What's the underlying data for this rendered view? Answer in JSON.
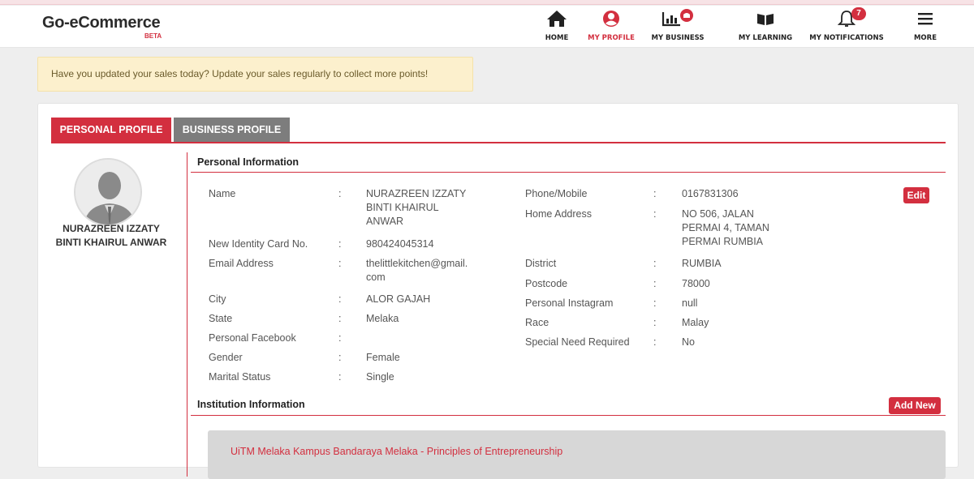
{
  "brand": {
    "name": "Go-eCommerce",
    "tag": "BETA"
  },
  "nav": [
    {
      "label": "HOME",
      "icon": "home-icon",
      "active": false,
      "badge": ""
    },
    {
      "label": "MY PROFILE",
      "icon": "user-icon",
      "active": true,
      "badge": ""
    },
    {
      "label": "MY BUSINESS",
      "icon": "bar-chart-icon",
      "active": false,
      "badge": ""
    },
    {
      "label": "MY LEARNING",
      "icon": "book-icon",
      "active": false,
      "badge": ""
    },
    {
      "label": "MY NOTIFICATIONS",
      "icon": "bell-icon",
      "active": false,
      "badge": "7"
    },
    {
      "label": "MORE",
      "icon": "menu-icon",
      "active": false,
      "badge": ""
    }
  ],
  "alert": {
    "text": "Have you updated your sales today? Update your sales regularly to collect more points!"
  },
  "tabs": {
    "personal": "PERSONAL PROFILE",
    "business": "BUSINESS PROFILE"
  },
  "profile": {
    "name_line1": "NURAZREEN IZZATY",
    "name_line2": "BINTI KHAIRUL ANWAR"
  },
  "personal": {
    "title": "Personal Information",
    "edit_label": "Edit",
    "colon": ":",
    "left": {
      "name_label": "Name",
      "name_l1": "NURAZREEN IZZATY",
      "name_l2": "BINTI KHAIRUL",
      "name_l3": "ANWAR",
      "ic_label": "New Identity Card No.",
      "ic_value": "980424045314",
      "email_label": "Email Address",
      "email_l1": "thelittlekitchen@gmail.",
      "email_l2": "com",
      "city_label": "City",
      "city_value": "ALOR GAJAH",
      "state_label": "State",
      "state_value": "Melaka",
      "fb_label": "Personal Facebook",
      "fb_value": "",
      "gender_label": "Gender",
      "gender_value": "Female",
      "marital_label": "Marital Status",
      "marital_value": "Single"
    },
    "right": {
      "phone_label": "Phone/Mobile",
      "phone_value": "0167831306",
      "addr_label": "Home Address",
      "addr_l1": "NO 506, JALAN",
      "addr_l2": "PERMAI 4, TAMAN",
      "addr_l3": "PERMAI RUMBIA",
      "district_label": "District",
      "district_value": "RUMBIA",
      "postcode_label": "Postcode",
      "postcode_value": "78000",
      "ig_label": "Personal Instagram",
      "ig_value": "null",
      "race_label": "Race",
      "race_value": "Malay",
      "special_label": "Special Need Required",
      "special_value": "No"
    }
  },
  "institution": {
    "title": "Institution Information",
    "add_label": "Add New",
    "item": "UiTM Melaka Kampus Bandaraya Melaka - Principles of Entrepreneurship"
  }
}
